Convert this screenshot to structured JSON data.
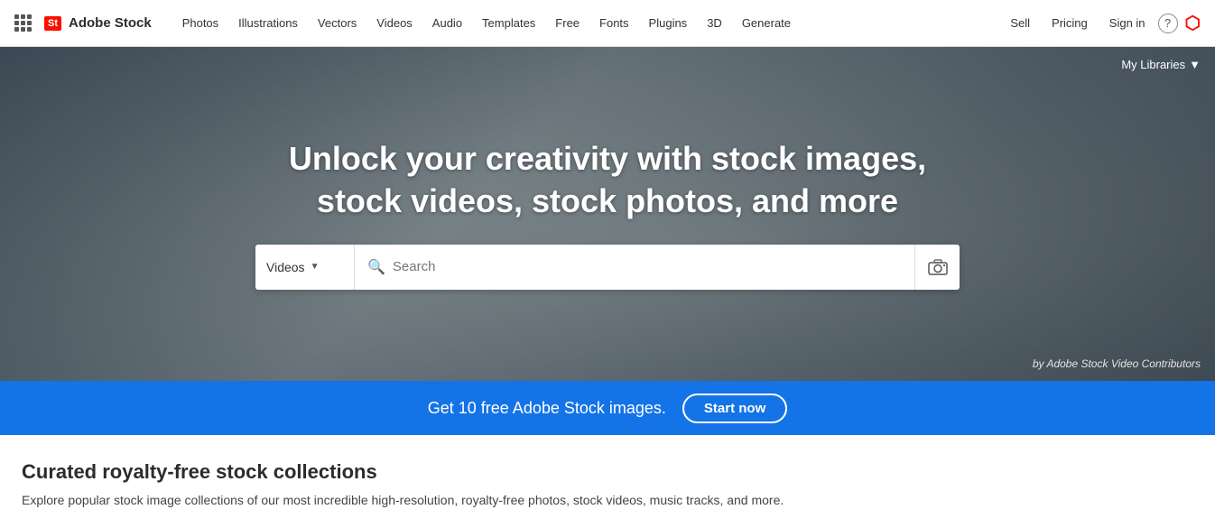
{
  "nav": {
    "grid_label": "apps-grid",
    "logo_badge": "St",
    "logo_text": "Adobe Stock",
    "links": [
      {
        "label": "Photos",
        "name": "nav-photos"
      },
      {
        "label": "Illustrations",
        "name": "nav-illustrations"
      },
      {
        "label": "Vectors",
        "name": "nav-vectors"
      },
      {
        "label": "Videos",
        "name": "nav-videos"
      },
      {
        "label": "Audio",
        "name": "nav-audio"
      },
      {
        "label": "Templates",
        "name": "nav-templates"
      },
      {
        "label": "Free",
        "name": "nav-free"
      },
      {
        "label": "Fonts",
        "name": "nav-fonts"
      },
      {
        "label": "Plugins",
        "name": "nav-plugins"
      },
      {
        "label": "3D",
        "name": "nav-3d"
      },
      {
        "label": "Generate",
        "name": "nav-generate"
      }
    ],
    "right_links": [
      {
        "label": "Sell",
        "name": "nav-sell"
      },
      {
        "label": "Pricing",
        "name": "nav-pricing"
      },
      {
        "label": "Sign in",
        "name": "nav-signin"
      }
    ]
  },
  "hero": {
    "title_line1": "Unlock your creativity with stock images,",
    "title_line2": "stock videos, stock photos, and more",
    "search_dropdown_label": "Videos",
    "search_placeholder": "Search",
    "attribution": "by Adobe Stock Video Contributors",
    "my_libraries": "My Libraries"
  },
  "promo": {
    "text": "Get 10 free Adobe Stock images.",
    "button_label": "Start now"
  },
  "curated": {
    "title": "Curated royalty-free stock collections",
    "description": "Explore popular stock image collections of our most incredible high-resolution, royalty-free photos, stock videos, music tracks, and more."
  }
}
